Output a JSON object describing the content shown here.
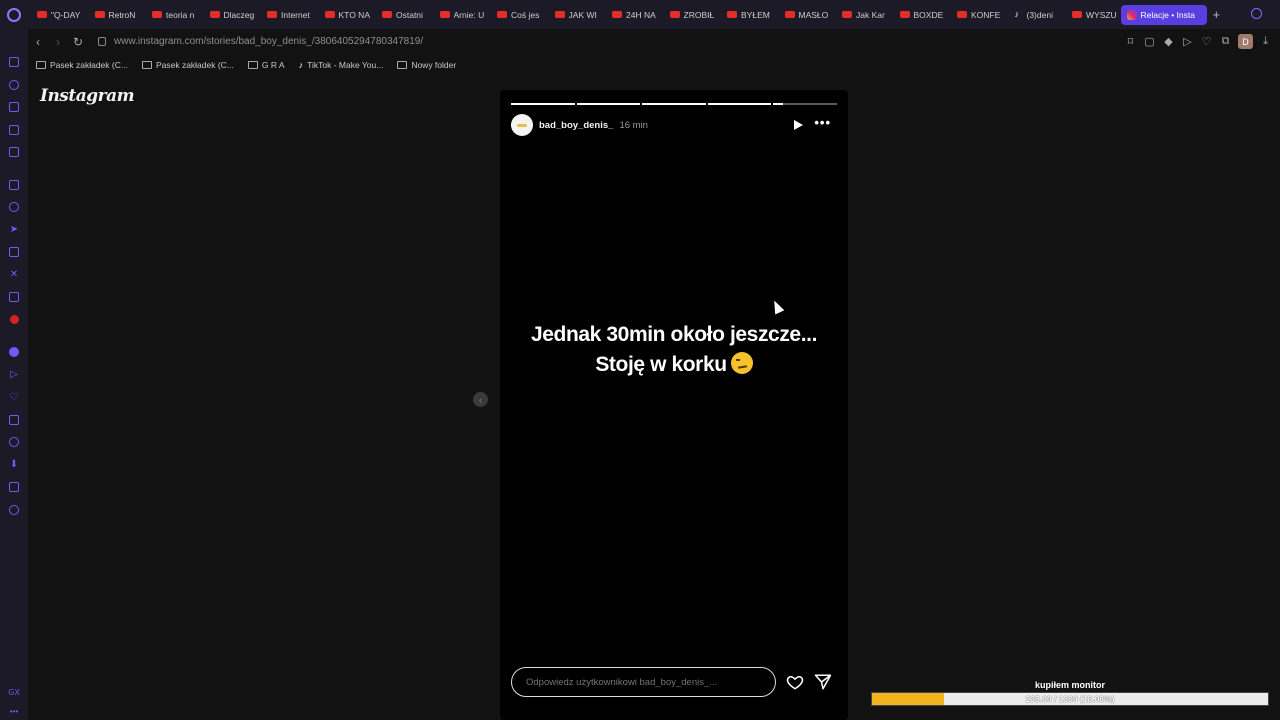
{
  "browser": {
    "tabs": [
      {
        "label": "\"Q-DAY",
        "icon": "youtube-icon"
      },
      {
        "label": "RetroN",
        "icon": "youtube-icon"
      },
      {
        "label": "teoria n",
        "icon": "youtube-icon"
      },
      {
        "label": "Dlaczeg",
        "icon": "youtube-icon"
      },
      {
        "label": "Internet",
        "icon": "youtube-icon"
      },
      {
        "label": "KTO NA",
        "icon": "youtube-icon"
      },
      {
        "label": "Ostatni",
        "icon": "youtube-icon"
      },
      {
        "label": "Arnie: U",
        "icon": "youtube-icon"
      },
      {
        "label": "Coś jes",
        "icon": "youtube-icon"
      },
      {
        "label": "JAK WI",
        "icon": "youtube-icon"
      },
      {
        "label": "24H NA",
        "icon": "youtube-icon"
      },
      {
        "label": "ZROBIŁ",
        "icon": "youtube-icon"
      },
      {
        "label": "BYŁEM",
        "icon": "youtube-icon"
      },
      {
        "label": "MASŁO",
        "icon": "youtube-icon"
      },
      {
        "label": "Jak Kar",
        "icon": "youtube-icon"
      },
      {
        "label": "BOXDE",
        "icon": "youtube-icon"
      },
      {
        "label": "KONFE",
        "icon": "youtube-icon"
      },
      {
        "label": "(3)deni",
        "icon": "tiktok-icon"
      },
      {
        "label": "WYSZU",
        "icon": "youtube-icon"
      }
    ],
    "active_tab": {
      "label": "Relacje • Insta",
      "icon": "instagram-icon"
    },
    "new_tab": "+",
    "url": "www.instagram.com/stories/bad_boy_denis_/3806405294780347819/",
    "bookmarks": [
      {
        "label": "Pasek zakładek (C...",
        "icon": "folder-icon"
      },
      {
        "label": "Pasek zakładek (C...",
        "icon": "folder-icon"
      },
      {
        "label": "G R A",
        "icon": "folder-icon"
      },
      {
        "label": "TikTok - Make You...",
        "icon": "tiktok-icon"
      },
      {
        "label": "Nowy folder",
        "icon": "folder-icon"
      }
    ],
    "profile_initial": "D",
    "sidebar_bottom_label": "GX"
  },
  "instagram": {
    "logo": "Instagram",
    "story": {
      "username": "bad_boy_denis_",
      "time": "16 min",
      "progress_fractions": [
        1,
        1,
        1,
        1,
        0.15
      ],
      "line1": "Jednak 30min około jeszcze...",
      "line2": "Stoję w korku",
      "reply_placeholder": "Odpowiedz użytkownikowi bad_boy_denis_..."
    },
    "prev_arrow": "‹"
  },
  "goal_widget": {
    "title": "kupiłem monitor",
    "current": 235,
    "total": 1300,
    "text": "235.00 / 1300 (18.08%)",
    "fraction": 0.1808,
    "fill_color": "#f0b31c"
  }
}
